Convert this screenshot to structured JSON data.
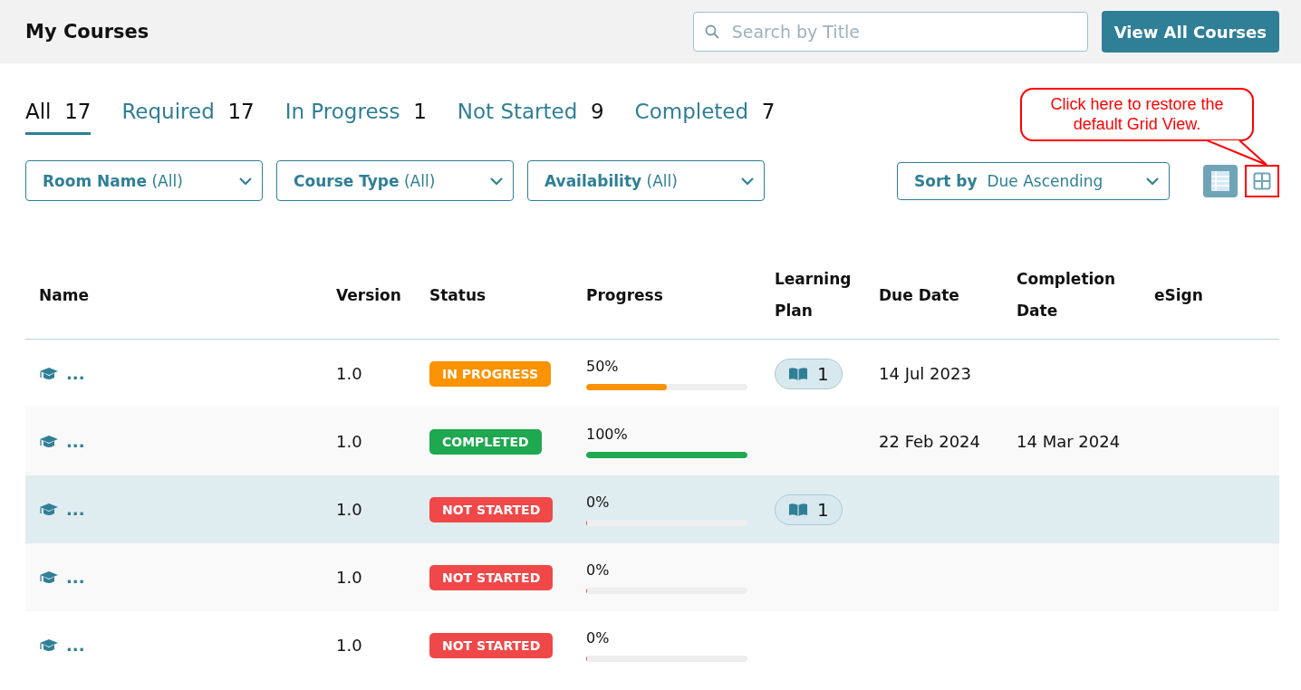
{
  "header": {
    "title": "My Courses",
    "search": {
      "placeholder": "Search by Title"
    },
    "view_all_button": "View All Courses"
  },
  "tabs": [
    {
      "label": "All",
      "count": "17",
      "selected": true
    },
    {
      "label": "Required",
      "count": "17",
      "selected": false
    },
    {
      "label": "In Progress",
      "count": "1",
      "selected": false
    },
    {
      "label": "Not Started",
      "count": "9",
      "selected": false
    },
    {
      "label": "Completed",
      "count": "7",
      "selected": false
    }
  ],
  "filters": [
    {
      "label": "Room Name",
      "value": "(All)"
    },
    {
      "label": "Course Type",
      "value": "(All)"
    },
    {
      "label": "Availability",
      "value": "(All)"
    }
  ],
  "sort": {
    "label": "Sort by",
    "value": "Due Ascending"
  },
  "view_buttons": [
    {
      "kind": "list",
      "selected": true,
      "highlighted": false
    },
    {
      "kind": "grid",
      "selected": false,
      "highlighted": true
    }
  ],
  "annotation": {
    "text": "Click here to restore the default Grid View."
  },
  "table": {
    "columns": [
      "Name",
      "Version",
      "Status",
      "Progress",
      "Learning Plan",
      "Due Date",
      "Completion Date",
      "eSign"
    ],
    "rows": [
      {
        "name": "...",
        "version": "1.0",
        "status": {
          "kind": "in_progress",
          "label": "IN PROGRESS"
        },
        "progress": "50%",
        "level": 0.5,
        "learning_plan": "1",
        "due_date": "14 Jul 2023",
        "completion_date": "",
        "selected": false
      },
      {
        "name": "...",
        "version": "1.0",
        "status": {
          "kind": "completed",
          "label": "COMPLETED"
        },
        "progress": "100%",
        "level": 1,
        "learning_plan": "",
        "due_date": "22 Feb 2024",
        "completion_date": "14 Mar 2024",
        "selected": false
      },
      {
        "name": "...",
        "version": "1.0",
        "status": {
          "kind": "not_started",
          "label": "NOT STARTED"
        },
        "progress": "0%",
        "level": 0,
        "learning_plan": "1",
        "due_date": "",
        "completion_date": "",
        "selected": true
      },
      {
        "name": "...",
        "version": "1.0",
        "status": {
          "kind": "not_started",
          "label": "NOT STARTED"
        },
        "progress": "0%",
        "level": 0,
        "learning_plan": "",
        "due_date": "",
        "completion_date": "",
        "selected": false
      },
      {
        "name": "...",
        "version": "1.0",
        "status": {
          "kind": "not_started",
          "label": "NOT STARTED"
        },
        "progress": "0%",
        "level": 0,
        "learning_plan": "",
        "due_date": "",
        "completion_date": "",
        "selected": false
      }
    ]
  }
}
